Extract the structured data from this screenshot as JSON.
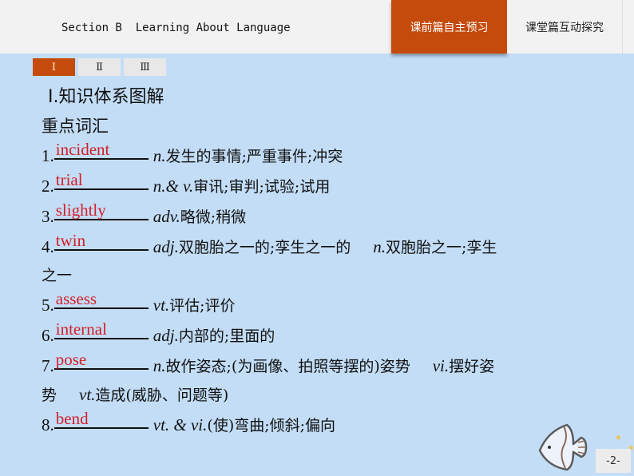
{
  "header": {
    "title": "Section B  Learning About Language",
    "nav_tabs": [
      {
        "label": "课前篇自主预习",
        "active": true
      },
      {
        "label": "课堂篇互动探究",
        "active": false
      }
    ]
  },
  "sub_tabs": [
    {
      "label": "Ⅰ",
      "active": true
    },
    {
      "label": "Ⅱ",
      "active": false
    },
    {
      "label": "Ⅲ",
      "active": false
    }
  ],
  "content": {
    "heading": "Ⅰ.知识体系图解",
    "subheading": "重点词汇",
    "items": [
      {
        "num": "1.",
        "answer": "incident",
        "parts": [
          {
            "pos": "n.",
            "def": "发生的事情;严重事件;冲突"
          }
        ]
      },
      {
        "num": "2.",
        "answer": "trial",
        "parts": [
          {
            "pos": "n.& v.",
            "def": "审讯;审判;试验;试用"
          }
        ]
      },
      {
        "num": "3.",
        "answer": "slightly",
        "parts": [
          {
            "pos": "adv.",
            "def": "略微;稍微"
          }
        ]
      },
      {
        "num": "4.",
        "answer": "twin",
        "parts": [
          {
            "pos": "adj.",
            "def": "双胞胎之一的;孪生之一的"
          },
          {
            "pos": "n.",
            "def": "双胞胎之一;孪生"
          }
        ],
        "continuation": "之一"
      },
      {
        "num": "5.",
        "answer": "assess",
        "parts": [
          {
            "pos": "vt.",
            "def": "评估;评价"
          }
        ]
      },
      {
        "num": "6.",
        "answer": "internal",
        "parts": [
          {
            "pos": "adj.",
            "def": "内部的;里面的"
          }
        ]
      },
      {
        "num": "7.",
        "answer": "pose",
        "parts": [
          {
            "pos": "n.",
            "def": "故作姿态;(为画像、拍照等摆的)姿势"
          },
          {
            "pos": "vi.",
            "def": "摆好姿"
          }
        ],
        "continuation": "势",
        "continuation_parts": [
          {
            "pos": "vt.",
            "def": "造成(威胁、问题等)"
          }
        ]
      },
      {
        "num": "8.",
        "answer": "bend",
        "parts": [
          {
            "pos": "vt. & vi.",
            "def": "(使)弯曲;倾斜;偏向"
          }
        ]
      }
    ]
  },
  "footer": {
    "page_number": "-2-",
    "decoration": "fish-icon"
  },
  "colors": {
    "accent": "#c44b0c",
    "background": "#c3ddf6",
    "answer_text": "#d41f27",
    "header_bg": "#f2f2f2"
  }
}
